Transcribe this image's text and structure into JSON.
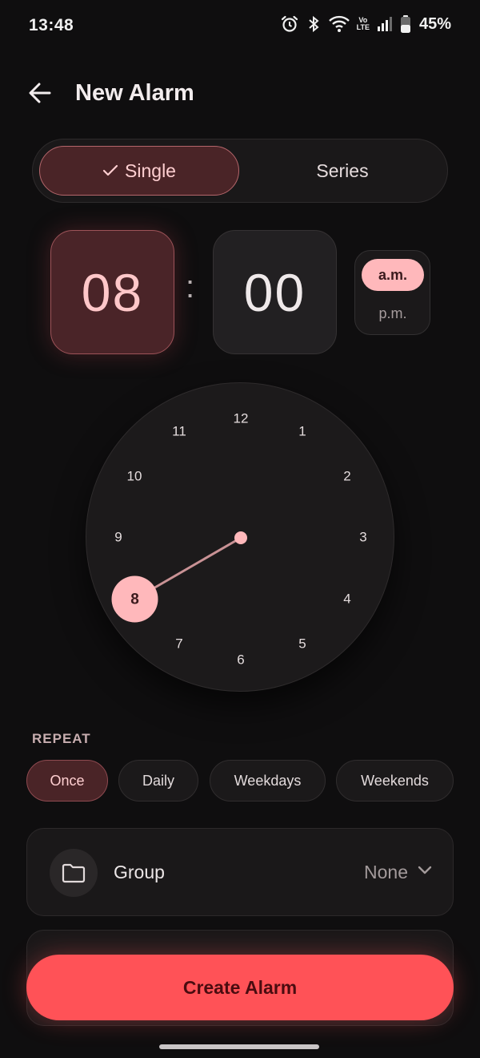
{
  "status_bar": {
    "time": "13:48",
    "battery": "45%",
    "volte_top": "Vo",
    "volte_bottom": "LTE",
    "icons": [
      "alarm-icon",
      "bluetooth-icon",
      "wifi-icon",
      "volte-icon",
      "signal-icon",
      "battery-icon"
    ]
  },
  "header": {
    "title": "New Alarm"
  },
  "mode_toggle": {
    "single_label": "Single",
    "series_label": "Series",
    "selected": "Single"
  },
  "time": {
    "hour": "08",
    "separator": ":",
    "minute": "00",
    "am_label": "a.m.",
    "pm_label": "p.m.",
    "selected_period": "a.m."
  },
  "clock": {
    "numbers": [
      "12",
      "1",
      "2",
      "3",
      "4",
      "5",
      "6",
      "7",
      "9",
      "10",
      "11"
    ],
    "selected_number": "8",
    "selected_hour": 8
  },
  "repeat": {
    "label": "REPEAT",
    "options": [
      "Once",
      "Daily",
      "Weekdays",
      "Weekends"
    ],
    "selected": "Once"
  },
  "group": {
    "label": "Group",
    "value": "None"
  },
  "create_button": {
    "label": "Create Alarm"
  },
  "colors": {
    "accent": "#ff5257",
    "accent_soft": "#ffb8bb",
    "background": "#0f0e0f",
    "selected_fill": "#4a2427"
  }
}
